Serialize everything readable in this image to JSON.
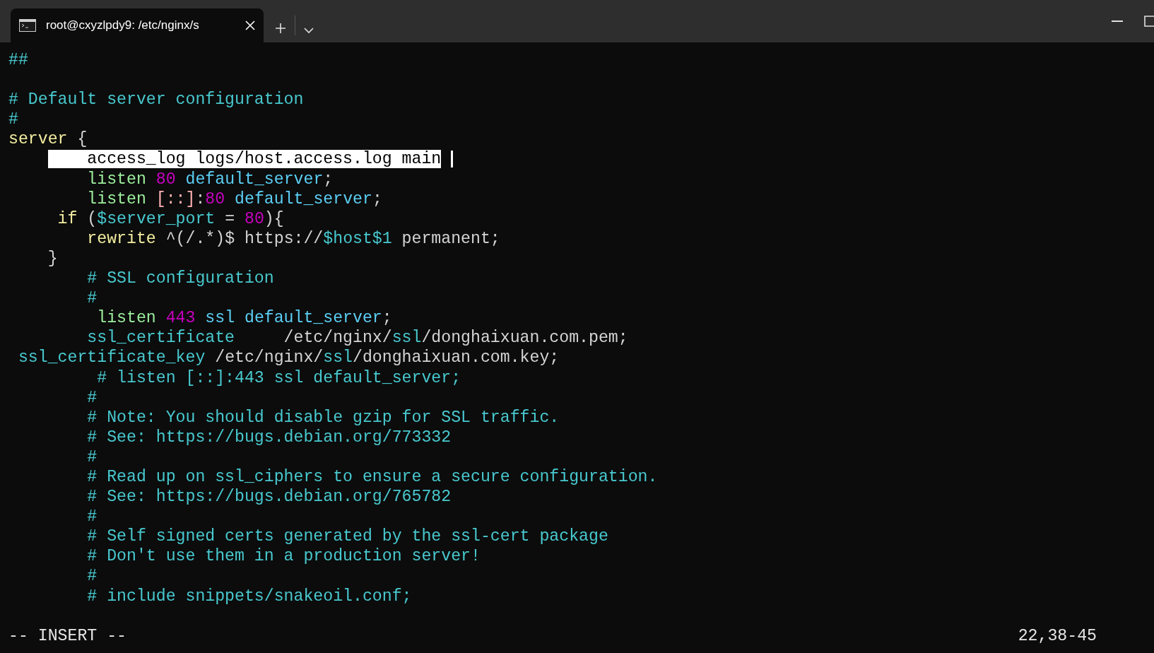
{
  "tab": {
    "title": "root@cxyzlpdy9: /etc/nginx/s",
    "selected": true
  },
  "lines": [
    {
      "cursor": false,
      "segments": [
        {
          "text": "##",
          "kind": "comment"
        }
      ]
    },
    {
      "kind": "blank"
    },
    {
      "cursor": false,
      "segments": [
        {
          "text": "# Default server configuration",
          "kind": "comment"
        }
      ]
    },
    {
      "cursor": false,
      "segments": [
        {
          "text": "#",
          "kind": "comment"
        }
      ]
    },
    {
      "cursor": false,
      "segments": [
        {
          "text": "server",
          "kind": "keyword"
        },
        {
          "text": " {",
          "kind": "plain"
        }
      ]
    },
    {
      "cursor": true,
      "segments": [
        {
          "text": "    access_log logs/host.access.log main",
          "kind": "selection"
        }
      ]
    },
    {
      "cursor": false,
      "segments": [
        {
          "text": "        listen ",
          "kind": "directive"
        },
        {
          "text": "80",
          "kind": "number"
        },
        {
          "text": " default_server",
          "kind": "value"
        },
        {
          "text": ";",
          "kind": "plain"
        }
      ]
    },
    {
      "cursor": false,
      "segments": [
        {
          "text": "        listen ",
          "kind": "directive"
        },
        {
          "text": "[::]",
          "kind": "bracket"
        },
        {
          "text": ":",
          "kind": "plain"
        },
        {
          "text": "80",
          "kind": "number"
        },
        {
          "text": " default_server",
          "kind": "value"
        },
        {
          "text": ";",
          "kind": "plain"
        }
      ]
    },
    {
      "cursor": false,
      "segments": [
        {
          "text": "     if",
          "kind": "keyword"
        },
        {
          "text": " (",
          "kind": "plain"
        },
        {
          "text": "$server_port",
          "kind": "variable"
        },
        {
          "text": " = ",
          "kind": "plain"
        },
        {
          "text": "80",
          "kind": "number"
        },
        {
          "text": "){",
          "kind": "plain"
        }
      ]
    },
    {
      "cursor": false,
      "segments": [
        {
          "text": "        rewrite",
          "kind": "keyword"
        },
        {
          "text": " ^(/.*)$ https://",
          "kind": "plain"
        },
        {
          "text": "$host$1",
          "kind": "variable"
        },
        {
          "text": " permanent;",
          "kind": "plain"
        }
      ]
    },
    {
      "cursor": false,
      "segments": [
        {
          "text": "    }",
          "kind": "plain"
        }
      ]
    },
    {
      "cursor": false,
      "segments": [
        {
          "text": "        # SSL configuration",
          "kind": "comment"
        }
      ]
    },
    {
      "cursor": false,
      "segments": [
        {
          "text": "        #",
          "kind": "comment"
        }
      ]
    },
    {
      "cursor": false,
      "segments": [
        {
          "text": "         listen ",
          "kind": "directive"
        },
        {
          "text": "443",
          "kind": "number"
        },
        {
          "text": " ssl default_server",
          "kind": "value"
        },
        {
          "text": ";",
          "kind": "plain"
        }
      ]
    },
    {
      "cursor": false,
      "segments": [
        {
          "text": "        ssl_certificate",
          "kind": "comment"
        },
        {
          "text": "     /etc/nginx/",
          "kind": "plain"
        },
        {
          "text": "ssl",
          "kind": "comment"
        },
        {
          "text": "/donghaixuan.com.pem;",
          "kind": "plain"
        }
      ]
    },
    {
      "cursor": false,
      "segments": [
        {
          "text": " ssl_certificate_key",
          "kind": "comment"
        },
        {
          "text": " /etc/nginx/",
          "kind": "plain"
        },
        {
          "text": "ssl",
          "kind": "comment"
        },
        {
          "text": "/donghaixuan.com.key;",
          "kind": "plain"
        }
      ]
    },
    {
      "cursor": false,
      "segments": [
        {
          "text": "         # listen [::]:443 ssl default_server;",
          "kind": "comment"
        }
      ]
    },
    {
      "cursor": false,
      "segments": [
        {
          "text": "        #",
          "kind": "comment"
        }
      ]
    },
    {
      "cursor": false,
      "segments": [
        {
          "text": "        # Note: You should disable gzip for SSL traffic.",
          "kind": "comment"
        }
      ]
    },
    {
      "cursor": false,
      "segments": [
        {
          "text": "        # See: https://bugs.debian.org/773332",
          "kind": "comment"
        }
      ]
    },
    {
      "cursor": false,
      "segments": [
        {
          "text": "        #",
          "kind": "comment"
        }
      ]
    },
    {
      "cursor": false,
      "segments": [
        {
          "text": "        # Read up on ssl_ciphers to ensure a secure configuration.",
          "kind": "comment"
        }
      ]
    },
    {
      "cursor": false,
      "segments": [
        {
          "text": "        # See: https://bugs.debian.org/765782",
          "kind": "comment"
        }
      ]
    },
    {
      "cursor": false,
      "segments": [
        {
          "text": "        #",
          "kind": "comment"
        }
      ]
    },
    {
      "cursor": false,
      "segments": [
        {
          "text": "        # Self signed certs generated by the ssl-cert package",
          "kind": "comment"
        }
      ]
    },
    {
      "cursor": false,
      "segments": [
        {
          "text": "        # Don't use them in a production server!",
          "kind": "comment"
        }
      ]
    },
    {
      "cursor": false,
      "segments": [
        {
          "text": "        #",
          "kind": "comment"
        }
      ]
    },
    {
      "cursor": false,
      "segments": [
        {
          "text": "        # include snippets/snakeoil.conf;",
          "kind": "comment"
        }
      ]
    },
    {
      "kind": "blank"
    }
  ],
  "status_bar": {
    "mode": "-- INSERT --",
    "position": "22,38-45"
  }
}
